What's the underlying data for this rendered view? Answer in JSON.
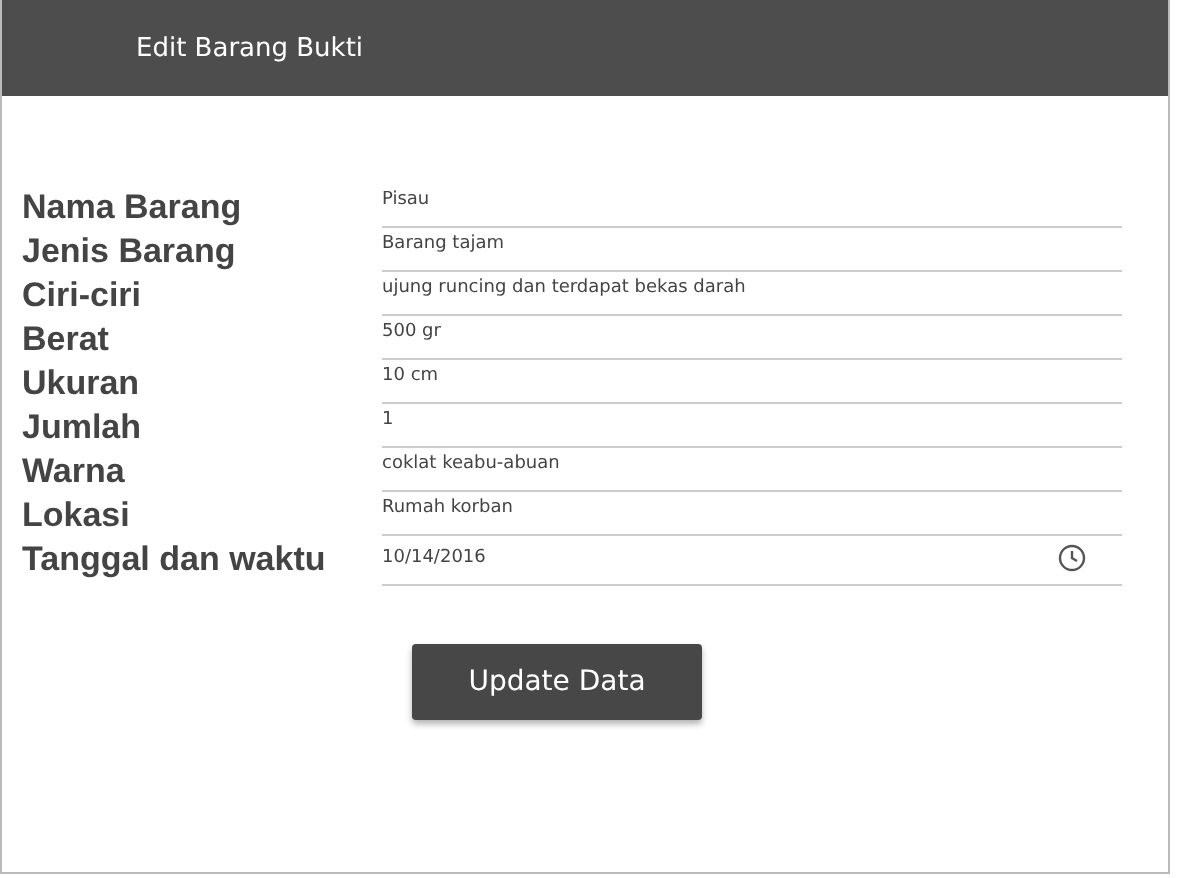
{
  "window": {
    "title": "Edit Barang Bukti"
  },
  "fields": [
    {
      "label": "Nama Barang",
      "value": "Pisau",
      "kind": "text"
    },
    {
      "label": "Jenis Barang",
      "value": "Barang tajam",
      "kind": "text"
    },
    {
      "label": "Ciri-ciri",
      "value": "ujung runcing dan terdapat bekas darah",
      "kind": "text"
    },
    {
      "label": "Berat",
      "value": "500 gr",
      "kind": "text"
    },
    {
      "label": "Ukuran",
      "value": "10 cm",
      "kind": "text"
    },
    {
      "label": "Jumlah",
      "value": "1",
      "kind": "text"
    },
    {
      "label": "Warna",
      "value": "coklat keabu-abuan",
      "kind": "text"
    },
    {
      "label": "Lokasi",
      "value": "Rumah korban",
      "kind": "text"
    },
    {
      "label": "Tanggal dan waktu",
      "value": "10/14/2016",
      "kind": "datetime"
    }
  ],
  "buttons": [
    "Update Data"
  ]
}
